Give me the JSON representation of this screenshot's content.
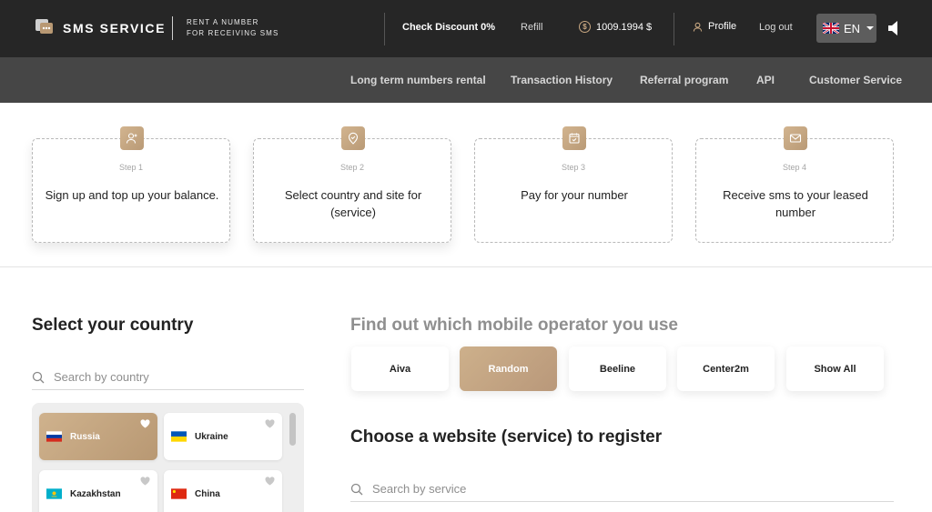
{
  "header": {
    "brand": "SMS SERVICE",
    "tagline_line1": "RENT A NUMBER",
    "tagline_line2": "FOR RECEIVING SMS",
    "check_discount": "Check Discount 0%",
    "refill": "Refill",
    "balance": "1009.1994 $",
    "profile": "Profile",
    "logout": "Log out",
    "language": "EN"
  },
  "nav": {
    "items": [
      "Long term numbers rental",
      "Transaction History",
      "Referral program",
      "API",
      "Customer Service"
    ]
  },
  "steps": [
    {
      "label": "Step 1",
      "text": "Sign up and top up your balance.",
      "icon": "add-user-icon"
    },
    {
      "label": "Step 2",
      "text": "Select country and site for (service)",
      "icon": "location-pin-icon"
    },
    {
      "label": "Step 3",
      "text": "Pay for your number",
      "icon": "calendar-check-icon"
    },
    {
      "label": "Step 4",
      "text": "Receive sms to your leased number",
      "icon": "mail-icon"
    }
  ],
  "country": {
    "title": "Select your country",
    "search_placeholder": "Search by country",
    "items": [
      {
        "name": "Russia",
        "selected": true
      },
      {
        "name": "Ukraine",
        "selected": false
      },
      {
        "name": "Kazakhstan",
        "selected": false
      },
      {
        "name": "China",
        "selected": false
      }
    ]
  },
  "operators": {
    "title": "Find out which mobile operator you use",
    "items": [
      "Aiva",
      "Random",
      "Beeline",
      "Center2m",
      "Show All"
    ],
    "selected": "Random"
  },
  "service": {
    "title": "Choose a website (service) to register",
    "search_placeholder": "Search by service"
  },
  "colors": {
    "accent": "#c4a57f",
    "header_bg": "#262626",
    "nav_bg": "#464646"
  }
}
